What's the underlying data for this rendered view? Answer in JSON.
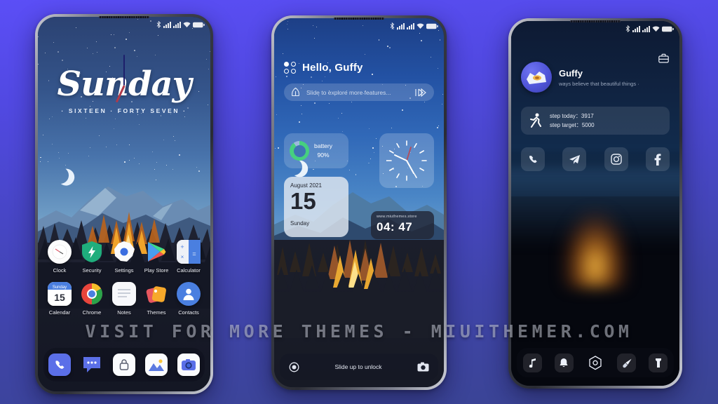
{
  "watermark": {
    "text": "VISIT FOR MORE THEMES - MIUITHEMER.COM"
  },
  "status_bar": {
    "icons": [
      "bluetooth-icon",
      "signal-1-icon",
      "signal-2-icon",
      "wifi-icon",
      "battery-icon"
    ]
  },
  "phone1": {
    "name": "home-screen",
    "clock_widget": {
      "day": "Sunday",
      "subtitle": "· SIXTEEN · FORTY SEVEN ·"
    },
    "apps_row1": [
      {
        "label": "Clock",
        "icon": "clock-icon"
      },
      {
        "label": "Security",
        "icon": "shield-bolt-icon"
      },
      {
        "label": "Settings",
        "icon": "settings-gear-icon"
      },
      {
        "label": "Play Store",
        "icon": "play-store-icon"
      },
      {
        "label": "Calculator",
        "icon": "calculator-icon"
      }
    ],
    "apps_row2": [
      {
        "label": "Calendar",
        "icon": "calendar-icon",
        "cal_day": "Sunday",
        "cal_date": "15"
      },
      {
        "label": "Chrome",
        "icon": "chrome-icon"
      },
      {
        "label": "Notes",
        "icon": "notes-icon"
      },
      {
        "label": "Themes",
        "icon": "themes-icon"
      },
      {
        "label": "Contacts",
        "icon": "contacts-icon"
      }
    ],
    "dock": [
      {
        "label": "Phone",
        "icon": "phone-icon"
      },
      {
        "label": "Messages",
        "icon": "messages-icon"
      },
      {
        "label": "Security",
        "icon": "lock-icon"
      },
      {
        "label": "Gallery",
        "icon": "gallery-icon"
      },
      {
        "label": "Camera",
        "icon": "camera-icon"
      }
    ]
  },
  "phone2": {
    "name": "lock-screen",
    "greeting": "Hello, Guffy",
    "search_placeholder": "Slide to explore more features...",
    "battery_widget": {
      "label": "battery",
      "value": "90%",
      "percent": 90
    },
    "date_widget": {
      "month_year": "August 2021",
      "day_number": "15",
      "weekday": "Sunday"
    },
    "time_widget": {
      "url": "www.miuthemes.store",
      "time": "04: 47"
    },
    "unlock": {
      "text": "Slide up to unlock",
      "left_icon": "record-icon",
      "right_icon": "camera-icon"
    }
  },
  "phone3": {
    "name": "profile-screen",
    "profile": {
      "name": "Guffy",
      "quote": "ways believe that beautiful things ·"
    },
    "steps": {
      "today_label": "step today：",
      "today_value": "3917",
      "target_label": "step target：",
      "target_value": "5000"
    },
    "social": [
      {
        "label": "Phone",
        "icon": "phone-icon"
      },
      {
        "label": "Telegram",
        "icon": "telegram-icon"
      },
      {
        "label": "Instagram",
        "icon": "instagram-icon"
      },
      {
        "label": "Facebook",
        "icon": "facebook-icon"
      }
    ],
    "dock": [
      {
        "label": "Music",
        "icon": "music-note-icon"
      },
      {
        "label": "Alarm",
        "icon": "bell-icon"
      },
      {
        "label": "Settings",
        "icon": "hex-gear-icon"
      },
      {
        "label": "Themes",
        "icon": "brush-icon"
      },
      {
        "label": "Flashlight",
        "icon": "flashlight-icon"
      }
    ]
  },
  "colors": {
    "background_top": "#5b4ef6",
    "background_bottom": "#3a4493",
    "accent_green": "#46d07f",
    "accent_blue": "#4a7fe0",
    "fire_orange": "#f0a32a"
  }
}
